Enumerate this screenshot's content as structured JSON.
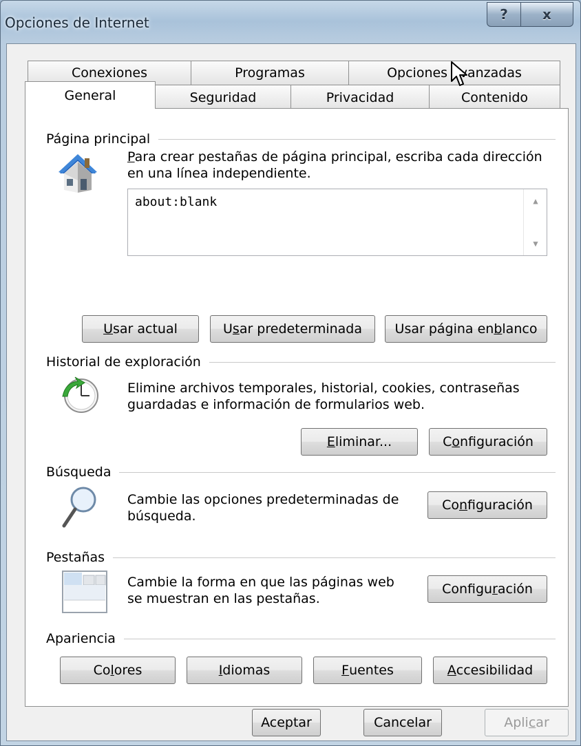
{
  "window": {
    "title": "Opciones de Internet",
    "help_label": "?",
    "close_label": "x"
  },
  "tabs": {
    "back_row": [
      {
        "label": "Conexiones"
      },
      {
        "label": "Programas"
      },
      {
        "label": "Opciones avanzadas"
      }
    ],
    "front_row": [
      {
        "label": "General",
        "active": true
      },
      {
        "label": "Seguridad"
      },
      {
        "label": "Privacidad"
      },
      {
        "label": "Contenido"
      }
    ]
  },
  "home_page": {
    "group_label": "Página principal",
    "description_line1_u": "P",
    "description_line1": "ara crear pestañas de página principal, escriba cada dirección",
    "description_line2": "en una línea independiente.",
    "url_value": "about:blank",
    "buttons": [
      {
        "pre": "",
        "u": "U",
        "post": "sar actual"
      },
      {
        "pre": "U",
        "u": "s",
        "post": "ar predeterminada"
      },
      {
        "pre": "Usar página en ",
        "u": "b",
        "post": "lanco"
      }
    ]
  },
  "history": {
    "group_label": "Historial de exploración",
    "description_line1": "Elimine archivos temporales, historial, cookies, contraseñas",
    "description_line2": "guardadas e información de formularios web.",
    "delete_btn": {
      "pre": "",
      "u": "E",
      "post": "liminar..."
    },
    "settings_btn": {
      "pre": "C",
      "u": "o",
      "post": "nfiguración"
    }
  },
  "search": {
    "group_label": "Búsqueda",
    "description_line1": "Cambie las opciones predeterminadas de",
    "description_line2": "búsqueda.",
    "settings_btn": {
      "pre": "Co",
      "u": "n",
      "post": "figuración"
    }
  },
  "tabs_section": {
    "group_label": "Pestañas",
    "description_line1": "Cambie la forma en que las páginas web",
    "description_line2": "se muestran en las pestañas.",
    "settings_btn": {
      "pre": "Configu",
      "u": "r",
      "post": "ación"
    }
  },
  "appearance": {
    "group_label": "Apariencia",
    "buttons": [
      {
        "pre": "Co",
        "u": "l",
        "post": "ores"
      },
      {
        "pre": "",
        "u": "I",
        "post": "diomas"
      },
      {
        "pre": "",
        "u": "F",
        "post": "uentes"
      },
      {
        "pre": "",
        "u": "A",
        "post": "ccesibilidad"
      }
    ]
  },
  "footer": {
    "ok": "Aceptar",
    "cancel": "Cancelar",
    "apply_pre": "Apli",
    "apply_u": "c",
    "apply_post": "ar"
  },
  "colors": {
    "accent": "#3a6ea5"
  }
}
